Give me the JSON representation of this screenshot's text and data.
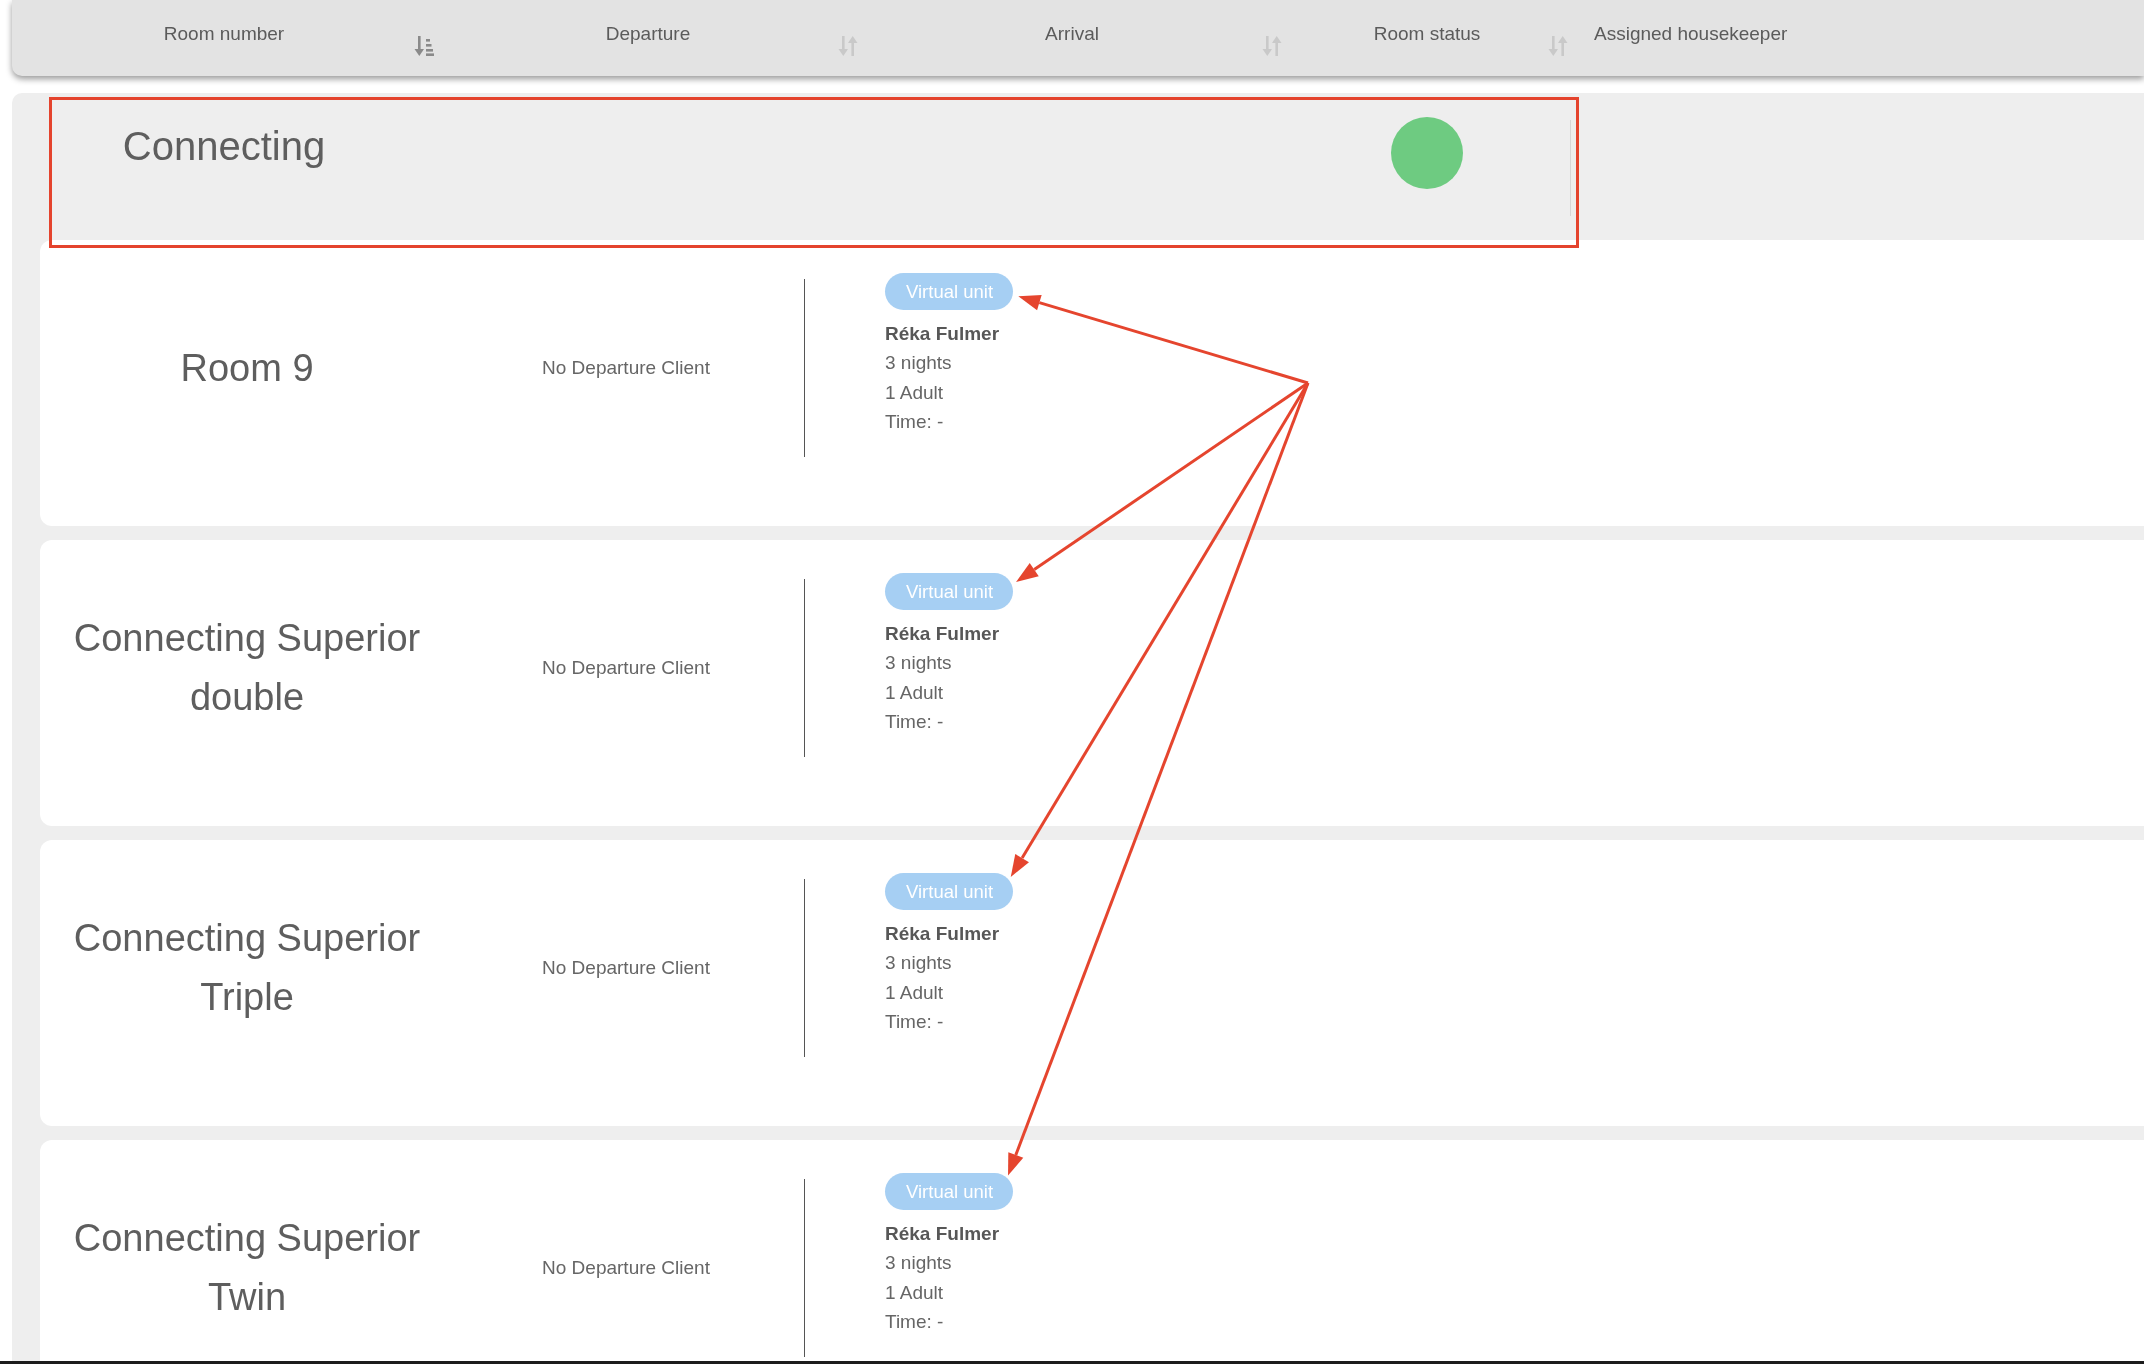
{
  "columns": [
    {
      "label": "Room number",
      "sorted": true
    },
    {
      "label": "Departure",
      "sorted": false
    },
    {
      "label": "Arrival",
      "sorted": false
    },
    {
      "label": "Room status",
      "sorted": false
    },
    {
      "label": "Assigned housekeeper"
    }
  ],
  "group": {
    "name": "Connecting",
    "color": "#6ecb81",
    "highlighted": true
  },
  "rooms": [
    {
      "name": "Room 9",
      "departure": "No Departure Client",
      "arrival": {
        "badge": "Virtual unit",
        "guest": "Réka Fulmer",
        "nights": "3 nights",
        "occupancy": "1 Adult",
        "time": "Time: -"
      }
    },
    {
      "name": "Connecting Superior double",
      "departure": "No Departure Client",
      "arrival": {
        "badge": "Virtual unit",
        "guest": "Réka Fulmer",
        "nights": "3 nights",
        "occupancy": "1 Adult",
        "time": "Time: -"
      }
    },
    {
      "name": "Connecting Superior Triple",
      "departure": "No Departure Client",
      "arrival": {
        "badge": "Virtual unit",
        "guest": "Réka Fulmer",
        "nights": "3 nights",
        "occupancy": "1 Adult",
        "time": "Time: -"
      }
    },
    {
      "name": "Connecting Superior Twin",
      "departure": "No Departure Client",
      "arrival": {
        "badge": "Virtual unit",
        "guest": "Réka Fulmer",
        "nights": "3 nights",
        "occupancy": "1 Adult",
        "time": "Time: -"
      }
    }
  ],
  "annotation_arrows": true
}
